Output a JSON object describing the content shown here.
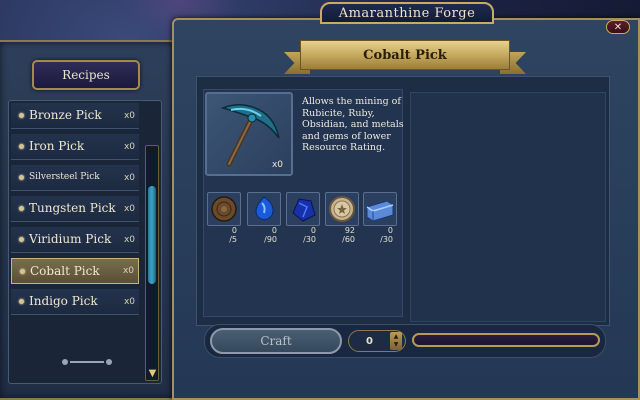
{
  "window": {
    "title": "Amaranthine Forge",
    "close_label": "✕"
  },
  "recipes_panel": {
    "tab_label": "Recipes",
    "items": [
      {
        "label": "Bronze Pick",
        "count": "x0",
        "selected": false
      },
      {
        "label": "Iron Pick",
        "count": "x0",
        "selected": false
      },
      {
        "label": "Silversteel Pick",
        "count": "x0",
        "selected": false
      },
      {
        "label": "Tungsten Pick",
        "count": "x0",
        "selected": false
      },
      {
        "label": "Viridium Pick",
        "count": "x0",
        "selected": false
      },
      {
        "label": "Cobalt Pick",
        "count": "x0",
        "selected": true
      },
      {
        "label": "Indigo Pick",
        "count": "x0",
        "selected": false
      }
    ],
    "scroll_up_icon": "triangle-up-icon",
    "scroll_down_icon": "triangle-down-icon"
  },
  "item": {
    "name": "Cobalt Pick",
    "owned": "x0",
    "description": "Allows the mining of Rubicite, Ruby, Obsidian, and metals and gems of lower Resource Rating.",
    "icon": "pickaxe-icon"
  },
  "materials": [
    {
      "icon": "wood-disc-icon",
      "have": "0",
      "need": "/5"
    },
    {
      "icon": "blue-gem-icon",
      "have": "0",
      "need": "/90"
    },
    {
      "icon": "dark-blue-gem-icon",
      "have": "0",
      "need": "/30"
    },
    {
      "icon": "tan-coin-icon",
      "have": "92",
      "need": "/60"
    },
    {
      "icon": "cobalt-bar-icon",
      "have": "0",
      "need": "/30"
    }
  ],
  "craft": {
    "button_label": "Craft",
    "quantity": "0",
    "progress": 0
  },
  "colors": {
    "accent_gold": "#c8ac62",
    "selected_row": "#7a6d4e",
    "scroll_thumb": "#3aa4c4"
  }
}
